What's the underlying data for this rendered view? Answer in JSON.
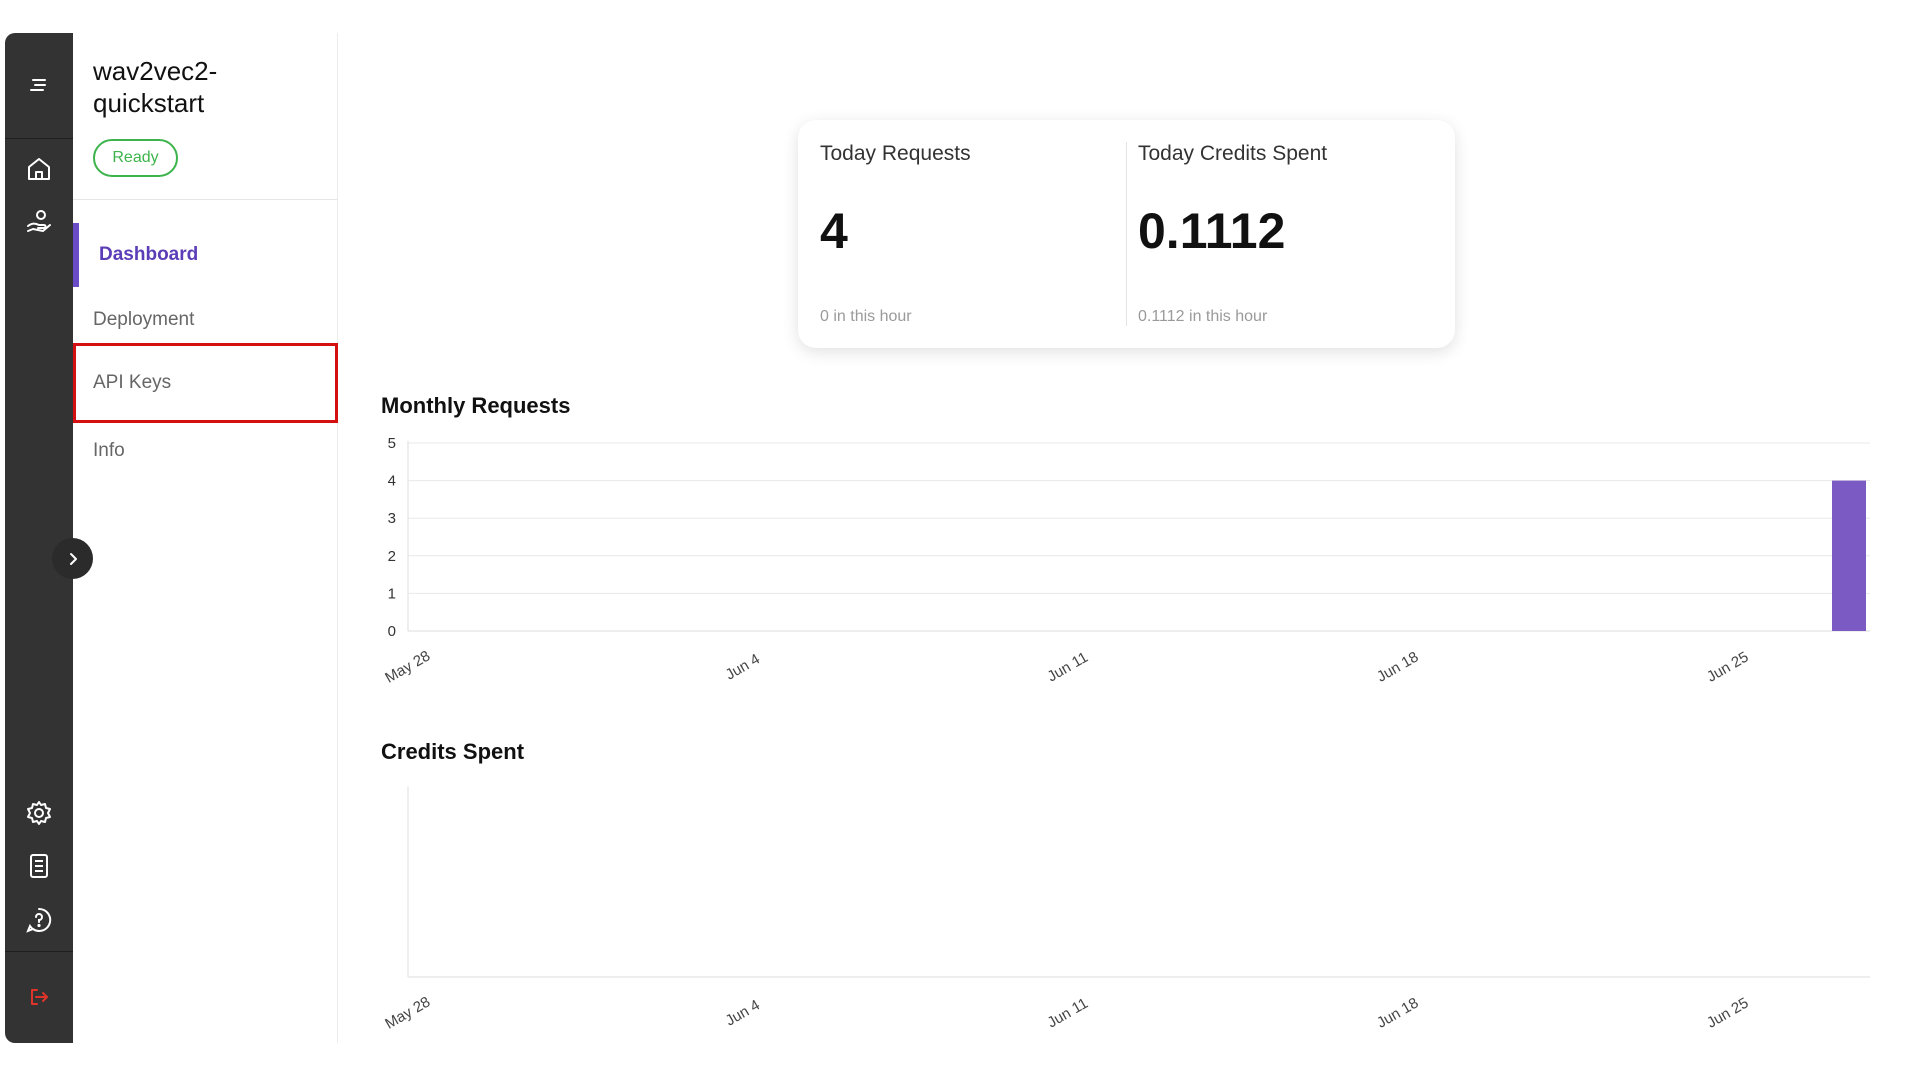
{
  "project": {
    "title": "wav2vec2-quickstart",
    "status": "Ready"
  },
  "nav": {
    "items": [
      {
        "label": "Dashboard",
        "active": true
      },
      {
        "label": "Deployment",
        "active": false
      },
      {
        "label": "API Keys",
        "active": false,
        "highlighted": true
      },
      {
        "label": "Info",
        "active": false
      }
    ]
  },
  "rail": {
    "top_icons": [
      "menu-icon",
      "home-icon",
      "hand-deploy-icon"
    ],
    "bottom_icons": [
      "gear-icon",
      "docs-icon",
      "help-chat-icon",
      "logout-icon"
    ]
  },
  "stats": {
    "requests": {
      "label": "Today Requests",
      "value": "4",
      "sub": "0 in this hour"
    },
    "credits": {
      "label": "Today Credits Spent",
      "value": "0.1112",
      "sub": "0.1112 in this hour"
    }
  },
  "colors": {
    "accent": "#6a4cc7",
    "bar": "#7b5ac4",
    "ready": "#3cb44b",
    "highlight": "#d40f0f",
    "rail": "#333333",
    "logout": "#e0342b"
  },
  "chart_data": [
    {
      "type": "bar",
      "title": "Monthly Requests",
      "x_tick_labels": [
        "May 28",
        "Jun 4",
        "Jun 11",
        "Jun 18",
        "Jun 25"
      ],
      "x": [
        "Jun 29"
      ],
      "values": [
        4
      ],
      "ylim": [
        0,
        5
      ],
      "y_ticks": [
        0,
        1,
        2,
        3,
        4,
        5
      ],
      "grid": true
    },
    {
      "type": "bar",
      "title": "Credits Spent",
      "x_tick_labels": [
        "May 28",
        "Jun 4",
        "Jun 11",
        "Jun 18",
        "Jun 25"
      ],
      "x": [],
      "values": [],
      "grid": false
    }
  ]
}
